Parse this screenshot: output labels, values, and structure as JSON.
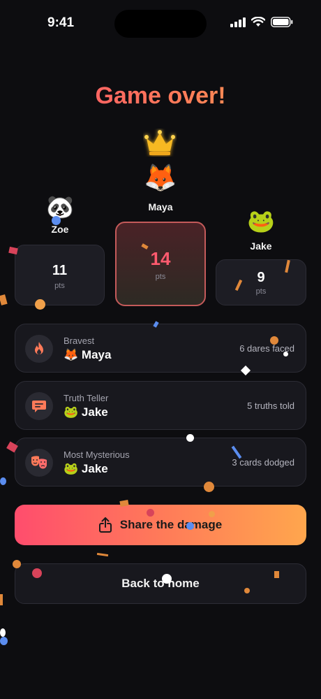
{
  "status": {
    "time": "9:41"
  },
  "title": "Game over!",
  "podium": {
    "first": {
      "emoji": "🦊",
      "name": "Maya",
      "score": "14",
      "pts_label": "pts"
    },
    "second": {
      "emoji": "🐼",
      "name": "Zoe",
      "score": "11",
      "pts_label": "pts"
    },
    "third": {
      "emoji": "🐸",
      "name": "Jake",
      "score": "9",
      "pts_label": "pts"
    }
  },
  "awards": [
    {
      "icon": "flame-icon",
      "title": "Bravest",
      "winner_emoji": "🦊",
      "winner": "Maya",
      "stat": "6 dares faced"
    },
    {
      "icon": "speech-bubble-icon",
      "title": "Truth Teller",
      "winner_emoji": "🐸",
      "winner": "Jake",
      "stat": "5 truths told"
    },
    {
      "icon": "theater-masks-icon",
      "title": "Most Mysterious",
      "winner_emoji": "🐸",
      "winner": "Jake",
      "stat": "3 cards dodged"
    }
  ],
  "buttons": {
    "share_label": "Share the damage",
    "home_label": "Back to home"
  },
  "colors": {
    "accent_start": "#ff4d6d",
    "accent_end": "#ffa64d",
    "background": "#0d0d10",
    "card": "#18181e"
  }
}
